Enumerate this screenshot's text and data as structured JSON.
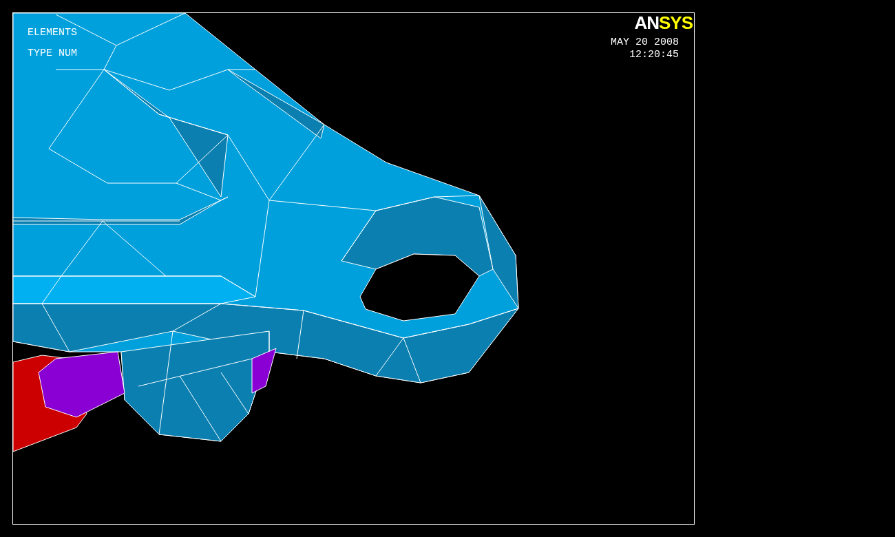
{
  "legend": {
    "lines": [
      "ELEMENTS",
      "TYPE NUM"
    ]
  },
  "logo": {
    "parts": [
      {
        "text": "AN",
        "color": "#ffffff"
      },
      {
        "text": "SYS",
        "color": "#ffff00"
      }
    ]
  },
  "timestamp": {
    "date": "MAY 20 2008",
    "time": "12:20:45"
  }
}
